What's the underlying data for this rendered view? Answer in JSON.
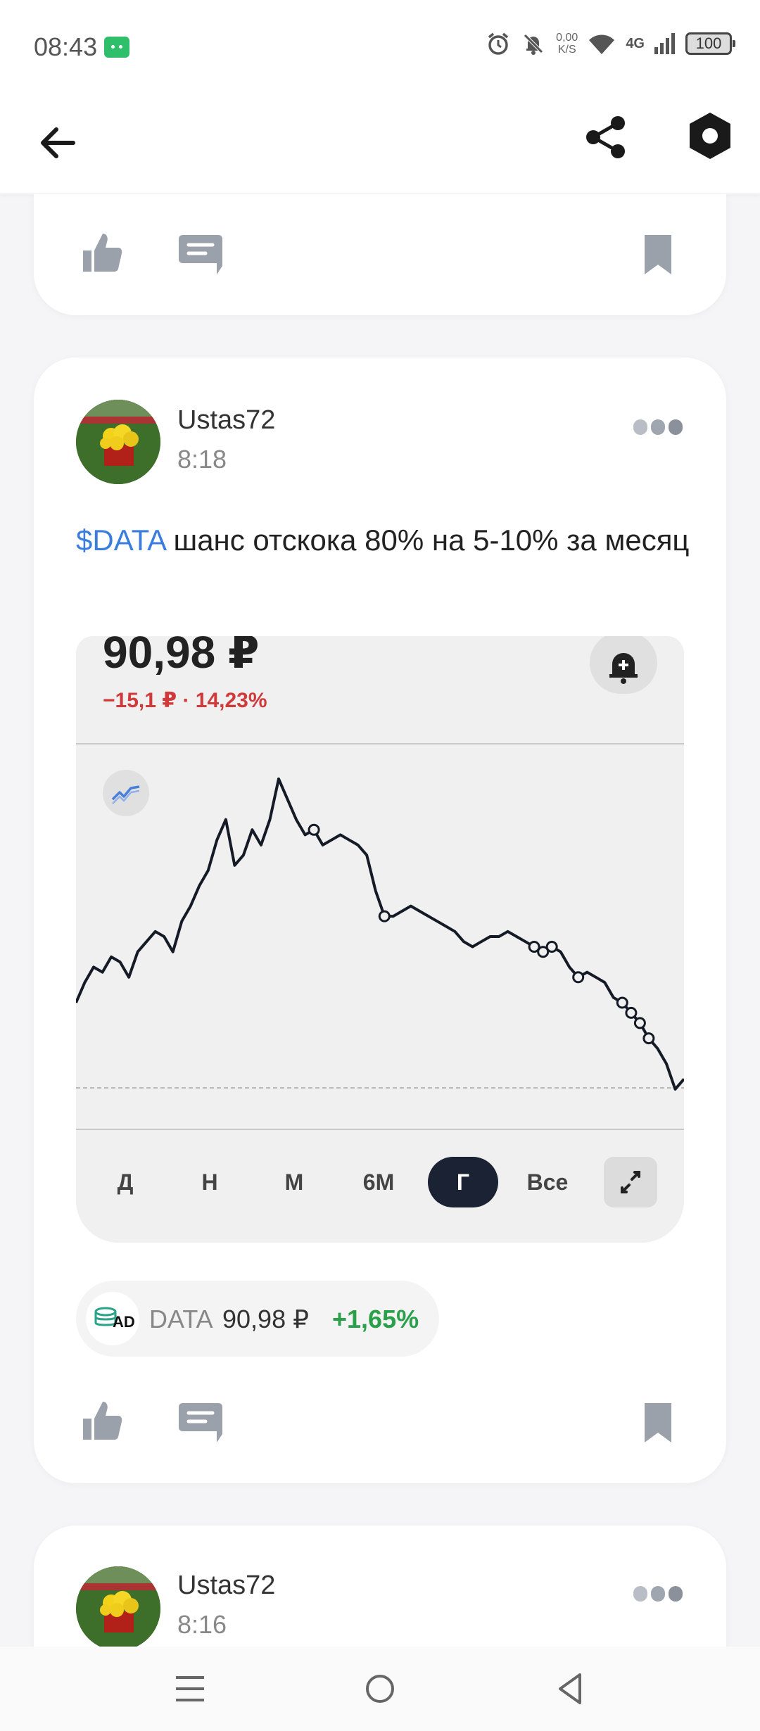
{
  "status_bar": {
    "time": "08:43",
    "net_speed_value": "0,00",
    "net_speed_unit": "K/S",
    "network": "4G",
    "battery": "100"
  },
  "app_bar": {
    "icons": [
      "back-arrow-icon",
      "share-icon",
      "settings-hex-icon"
    ]
  },
  "posts": [
    {
      "author": "Ustas72",
      "time": "8:18",
      "ticker_link": "$DATA",
      "text": " шанс отскока 80% на 5-10% за месяц",
      "widget": {
        "price": "90,98 ₽",
        "change": "−15,1 ₽ · 14,23%",
        "periods": [
          "Д",
          "Н",
          "М",
          "6М",
          "Г",
          "Все"
        ],
        "active_period": "Г"
      },
      "chip": {
        "logo_text": "AD",
        "ticker": "DATA",
        "price": "90,98 ₽",
        "change": "+1,65%"
      }
    },
    {
      "author": "Ustas72",
      "time": "8:16"
    }
  ],
  "colors": {
    "accent_link": "#3b7ddd",
    "negative": "#d13a3a",
    "positive": "#2ba04a",
    "active_period_bg": "#1b2233"
  },
  "chart_data": {
    "type": "line",
    "series": [
      {
        "values": [
          114,
          118,
          121,
          120,
          123,
          122,
          119,
          124,
          126,
          128,
          127,
          124,
          130,
          133,
          137,
          140,
          146,
          150,
          141,
          143,
          148,
          145,
          150,
          158,
          154,
          150,
          147,
          148,
          145,
          146,
          147,
          146,
          145,
          143,
          136,
          131,
          131,
          132,
          133,
          132,
          131,
          130,
          129,
          128,
          126,
          125,
          126,
          127,
          127,
          128,
          127,
          126,
          125,
          124,
          125,
          124,
          121,
          119,
          120,
          119,
          118,
          115,
          114,
          112,
          110,
          107,
          105,
          102,
          97,
          99
        ]
      }
    ],
    "ylim": [
      92,
      162
    ]
  }
}
